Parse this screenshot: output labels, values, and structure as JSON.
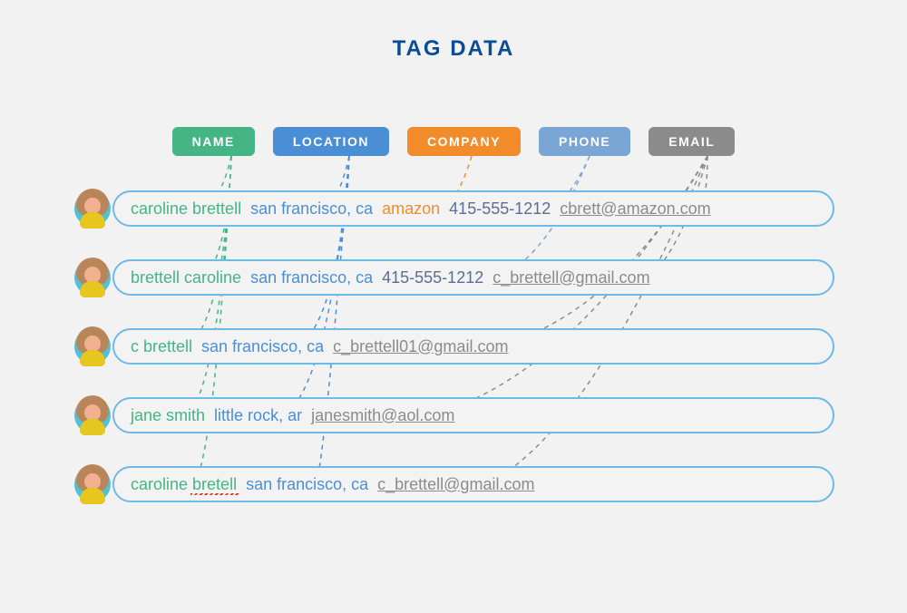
{
  "title": "TAG DATA",
  "tags": {
    "name": "NAME",
    "location": "LOCATION",
    "company": "COMPANY",
    "phone": "PHONE",
    "email": "EMAIL"
  },
  "colors": {
    "name": "#45b585",
    "location": "#4a8fd6",
    "company": "#f28c2b",
    "phone": "#7aa6d6",
    "email": "#8b8b8b"
  },
  "rows": [
    {
      "name": "caroline brettell",
      "location": "san francisco, ca",
      "company": "amazon",
      "phone": "415-555-1212",
      "email": "cbrett@amazon.com"
    },
    {
      "name": "brettell caroline",
      "location": "san francisco, ca",
      "company": "",
      "phone": "415-555-1212",
      "email": "c_brettell@gmail.com"
    },
    {
      "name": "c brettell",
      "location": "san francisco, ca",
      "company": "",
      "phone": "",
      "email": "c_brettell01@gmail.com"
    },
    {
      "name": "jane smith",
      "location": "little rock, ar",
      "company": "",
      "phone": "",
      "email": "janesmith@aol.com"
    },
    {
      "name": "caroline bretell",
      "location": "san francisco, ca",
      "company": "",
      "phone": "",
      "email": "c_brettell@gmail.com",
      "misspelled_word": "bretell"
    }
  ]
}
